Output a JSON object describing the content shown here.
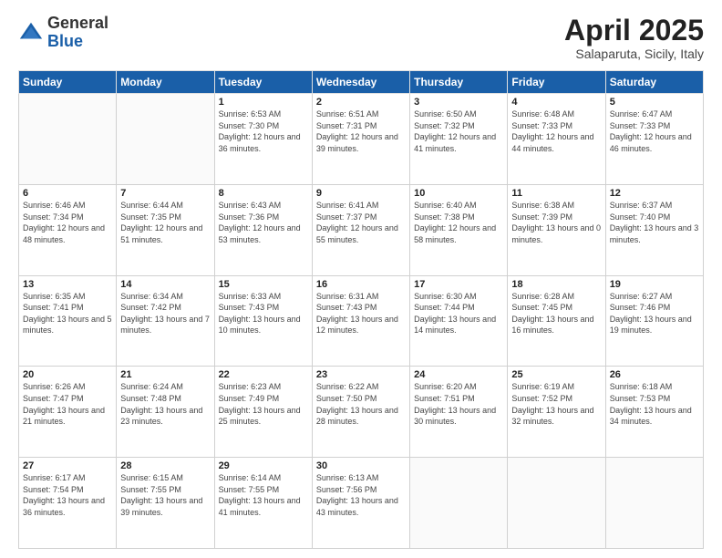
{
  "header": {
    "logo_general": "General",
    "logo_blue": "Blue",
    "month_title": "April 2025",
    "subtitle": "Salaparuta, Sicily, Italy"
  },
  "weekdays": [
    "Sunday",
    "Monday",
    "Tuesday",
    "Wednesday",
    "Thursday",
    "Friday",
    "Saturday"
  ],
  "weeks": [
    [
      {
        "day": "",
        "info": ""
      },
      {
        "day": "",
        "info": ""
      },
      {
        "day": "1",
        "info": "Sunrise: 6:53 AM\nSunset: 7:30 PM\nDaylight: 12 hours and 36 minutes."
      },
      {
        "day": "2",
        "info": "Sunrise: 6:51 AM\nSunset: 7:31 PM\nDaylight: 12 hours and 39 minutes."
      },
      {
        "day": "3",
        "info": "Sunrise: 6:50 AM\nSunset: 7:32 PM\nDaylight: 12 hours and 41 minutes."
      },
      {
        "day": "4",
        "info": "Sunrise: 6:48 AM\nSunset: 7:33 PM\nDaylight: 12 hours and 44 minutes."
      },
      {
        "day": "5",
        "info": "Sunrise: 6:47 AM\nSunset: 7:33 PM\nDaylight: 12 hours and 46 minutes."
      }
    ],
    [
      {
        "day": "6",
        "info": "Sunrise: 6:46 AM\nSunset: 7:34 PM\nDaylight: 12 hours and 48 minutes."
      },
      {
        "day": "7",
        "info": "Sunrise: 6:44 AM\nSunset: 7:35 PM\nDaylight: 12 hours and 51 minutes."
      },
      {
        "day": "8",
        "info": "Sunrise: 6:43 AM\nSunset: 7:36 PM\nDaylight: 12 hours and 53 minutes."
      },
      {
        "day": "9",
        "info": "Sunrise: 6:41 AM\nSunset: 7:37 PM\nDaylight: 12 hours and 55 minutes."
      },
      {
        "day": "10",
        "info": "Sunrise: 6:40 AM\nSunset: 7:38 PM\nDaylight: 12 hours and 58 minutes."
      },
      {
        "day": "11",
        "info": "Sunrise: 6:38 AM\nSunset: 7:39 PM\nDaylight: 13 hours and 0 minutes."
      },
      {
        "day": "12",
        "info": "Sunrise: 6:37 AM\nSunset: 7:40 PM\nDaylight: 13 hours and 3 minutes."
      }
    ],
    [
      {
        "day": "13",
        "info": "Sunrise: 6:35 AM\nSunset: 7:41 PM\nDaylight: 13 hours and 5 minutes."
      },
      {
        "day": "14",
        "info": "Sunrise: 6:34 AM\nSunset: 7:42 PM\nDaylight: 13 hours and 7 minutes."
      },
      {
        "day": "15",
        "info": "Sunrise: 6:33 AM\nSunset: 7:43 PM\nDaylight: 13 hours and 10 minutes."
      },
      {
        "day": "16",
        "info": "Sunrise: 6:31 AM\nSunset: 7:43 PM\nDaylight: 13 hours and 12 minutes."
      },
      {
        "day": "17",
        "info": "Sunrise: 6:30 AM\nSunset: 7:44 PM\nDaylight: 13 hours and 14 minutes."
      },
      {
        "day": "18",
        "info": "Sunrise: 6:28 AM\nSunset: 7:45 PM\nDaylight: 13 hours and 16 minutes."
      },
      {
        "day": "19",
        "info": "Sunrise: 6:27 AM\nSunset: 7:46 PM\nDaylight: 13 hours and 19 minutes."
      }
    ],
    [
      {
        "day": "20",
        "info": "Sunrise: 6:26 AM\nSunset: 7:47 PM\nDaylight: 13 hours and 21 minutes."
      },
      {
        "day": "21",
        "info": "Sunrise: 6:24 AM\nSunset: 7:48 PM\nDaylight: 13 hours and 23 minutes."
      },
      {
        "day": "22",
        "info": "Sunrise: 6:23 AM\nSunset: 7:49 PM\nDaylight: 13 hours and 25 minutes."
      },
      {
        "day": "23",
        "info": "Sunrise: 6:22 AM\nSunset: 7:50 PM\nDaylight: 13 hours and 28 minutes."
      },
      {
        "day": "24",
        "info": "Sunrise: 6:20 AM\nSunset: 7:51 PM\nDaylight: 13 hours and 30 minutes."
      },
      {
        "day": "25",
        "info": "Sunrise: 6:19 AM\nSunset: 7:52 PM\nDaylight: 13 hours and 32 minutes."
      },
      {
        "day": "26",
        "info": "Sunrise: 6:18 AM\nSunset: 7:53 PM\nDaylight: 13 hours and 34 minutes."
      }
    ],
    [
      {
        "day": "27",
        "info": "Sunrise: 6:17 AM\nSunset: 7:54 PM\nDaylight: 13 hours and 36 minutes."
      },
      {
        "day": "28",
        "info": "Sunrise: 6:15 AM\nSunset: 7:55 PM\nDaylight: 13 hours and 39 minutes."
      },
      {
        "day": "29",
        "info": "Sunrise: 6:14 AM\nSunset: 7:55 PM\nDaylight: 13 hours and 41 minutes."
      },
      {
        "day": "30",
        "info": "Sunrise: 6:13 AM\nSunset: 7:56 PM\nDaylight: 13 hours and 43 minutes."
      },
      {
        "day": "",
        "info": ""
      },
      {
        "day": "",
        "info": ""
      },
      {
        "day": "",
        "info": ""
      }
    ]
  ]
}
